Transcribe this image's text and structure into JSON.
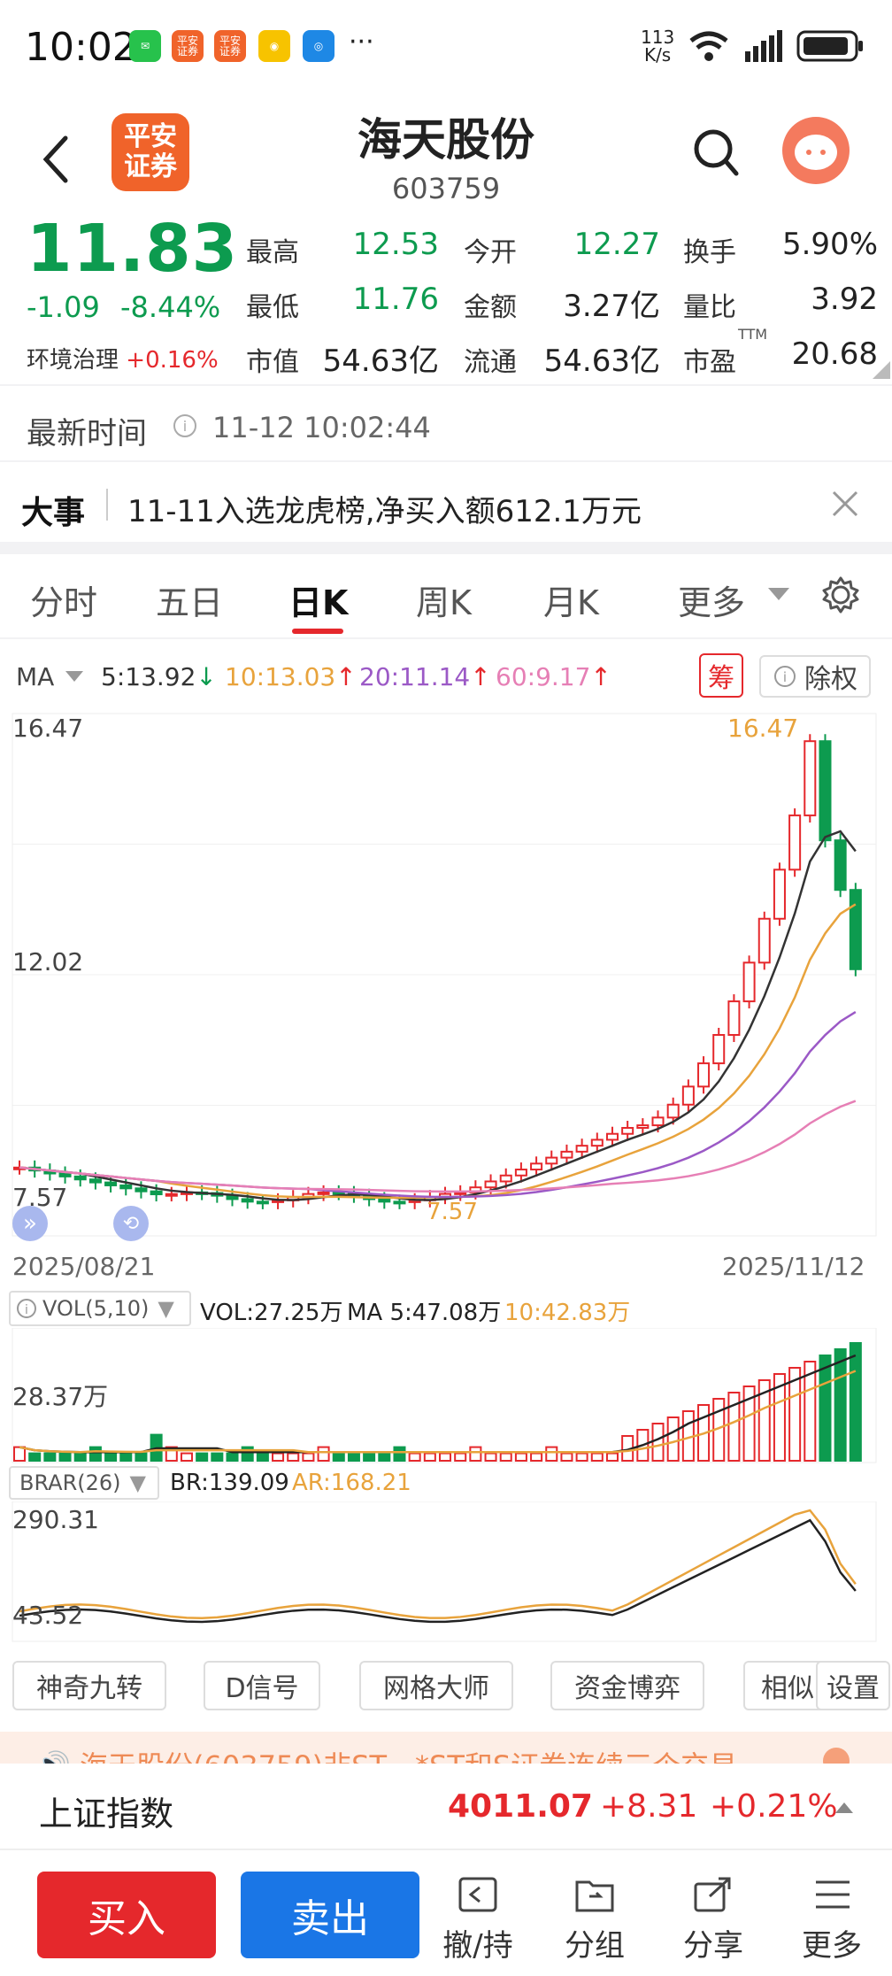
{
  "status_bar": {
    "time": "10:02",
    "net_speed_top": "113",
    "net_speed_bottom": "K/s",
    "app_icon_1": "平安",
    "app_icon_2": "证券",
    "more": "···"
  },
  "header": {
    "broker_logo_top": "平安",
    "broker_logo_bottom": "证券",
    "stock_name": "海天股份",
    "stock_code": "603759"
  },
  "quote": {
    "price": "11.83",
    "change": "-1.09",
    "change_pct": "-8.44%",
    "sector": "环境治理",
    "sector_pct": "+0.16%",
    "high_label": "最高",
    "high": "12.53",
    "open_label": "今开",
    "open": "12.27",
    "turnover_label": "换手",
    "turnover": "5.90%",
    "low_label": "最低",
    "low": "11.76",
    "amount_label": "金额",
    "amount": "3.27亿",
    "vol_ratio_label": "量比",
    "vol_ratio": "3.92",
    "mcap_label": "市值",
    "mcap": "54.63亿",
    "float_label": "流通",
    "float_cap": "54.63亿",
    "pe_label": "市盈",
    "pe_sup": "TTM",
    "pe": "20.68"
  },
  "update": {
    "label": "最新时间",
    "value": "11-12 10:02:44"
  },
  "event": {
    "tag": "大事",
    "text": "11-11入选龙虎榜,净买入额612.1万元"
  },
  "tabs": [
    "分时",
    "五日",
    "日K",
    "周K",
    "月K",
    "更多"
  ],
  "chart": {
    "ma_label": "MA",
    "ma5": "5:13.92",
    "ma10": "10:13.03",
    "ma20": "20:11.14",
    "ma60": "60:9.17",
    "chip_label": "筹",
    "adjust_label": "除权",
    "y_high": "16.47",
    "y_mid": "12.02",
    "y_low": "7.57",
    "peak_label": "16.47",
    "low_marker_label": "7.57",
    "date_start": "2025/08/21",
    "date_end": "2025/11/12",
    "vol_indicator": "VOL(5,10)",
    "vol_value": "VOL:27.25万",
    "vol_ma5": "MA 5:47.08万",
    "vol_ma10": "10:42.83万",
    "vol_axis": "28.37万",
    "brar_indicator": "BRAR(26)",
    "br": "BR:139.09",
    "ar": "AR:168.21",
    "brar_high": "290.31",
    "brar_low": "43.52",
    "colors": {
      "up": "#e5282c",
      "down": "#0d9b4f",
      "ma5": "#333333",
      "ma10": "#e8a33c",
      "ma20": "#9b59c6",
      "ma60": "#e67fb5"
    }
  },
  "features": [
    "神奇九转",
    "D信号",
    "网格大师",
    "资金博弈",
    "相似",
    "设置"
  ],
  "notice": {
    "text": "海天股份(603759)非ST、*ST和S证券连续三个交易"
  },
  "index_bar": {
    "name": "上证指数",
    "value": "4011.07",
    "change": "+8.31",
    "pct": "+0.21%"
  },
  "bottom": {
    "buy": "买入",
    "sell": "卖出",
    "cancel": "撤/持",
    "group": "分组",
    "share": "分享",
    "more": "更多"
  }
}
